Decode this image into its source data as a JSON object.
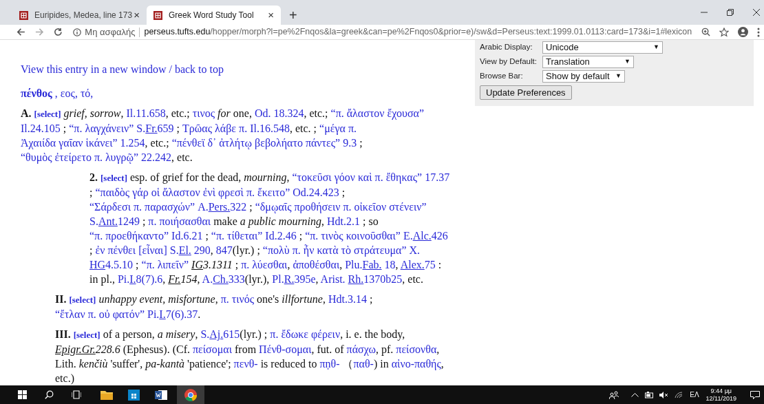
{
  "browser": {
    "tabs": [
      {
        "title": "Euripides, Medea, line 173",
        "selected": false,
        "close": "×"
      },
      {
        "title": "Greek Word Study Tool",
        "selected": true,
        "close": "×"
      }
    ],
    "new_tab": "+",
    "security_label": "Μη ασφαλής",
    "url_host": "perseus.tufts.edu",
    "url_path": "/hopper/morph?l=pe%2Fnqos&la=greek&can=pe%2Fnqos0&prior=e)/sw&d=Perseus:text:1999.01.0113:card=173&i=1#lexicon"
  },
  "nav": {
    "new_window": "View this entry in a new window",
    "separator": " / ",
    "back_to_top": "back to top"
  },
  "headword": "**πένθος** , εος, τό,",
  "senses": [
    {
      "segments": [
        {
          "kind": "label",
          "text": "A."
        },
        {
          "kind": "select",
          "text": "[select]",
          "spaced": true
        },
        {
          "kind": "plain",
          "text": " *grief, sorrow*, "
        },
        {
          "kind": "link",
          "text": "Il.11.658"
        },
        {
          "kind": "plain",
          "text": ", etc.; "
        },
        {
          "kind": "link",
          "text": "τινος"
        },
        {
          "kind": "plain",
          "text": " *for* one, "
        },
        {
          "kind": "link",
          "text": "Od. 18.324"
        },
        {
          "kind": "plain",
          "text": ", etc.; "
        },
        {
          "kind": "link",
          "text": "“π. ἄλαστον"
        },
        {
          "kind": "link",
          "text": "ἔχουσα”",
          "spaced": true
        },
        {
          "kind": "link",
          "text": "Il.24.105",
          "spaced": true
        },
        {
          "kind": "plain",
          "text": " ; "
        },
        {
          "kind": "link",
          "text": "“π. λαγχάνειν”"
        },
        {
          "kind": "link",
          "text": "S.",
          "spaced": true
        },
        {
          "kind": "ulink",
          "text": "Fr."
        },
        {
          "kind": "link",
          "text": "659"
        },
        {
          "kind": "plain",
          "text": " ; "
        },
        {
          "kind": "link",
          "text": "Τρῶας λάβε π."
        },
        {
          "kind": "link",
          "text": "Il.16.548",
          "spaced": true
        },
        {
          "kind": "plain",
          "text": ", etc. ; "
        },
        {
          "kind": "link",
          "text": "“μέγα π."
        },
        {
          "kind": "link",
          "text": "Ἀχαιίδα γαῖαν ἱκάνει”",
          "spaced": true
        },
        {
          "kind": "link",
          "text": "1.254",
          "spaced": true
        },
        {
          "kind": "plain",
          "text": ", etc.; "
        },
        {
          "kind": "link",
          "text": "“πένθεϊ δ᾽ ἀτλήτῳ βεβολήατο πάντες”"
        },
        {
          "kind": "link",
          "text": "9.3",
          "spaced": true
        },
        {
          "kind": "plain",
          "text": " ; "
        },
        {
          "kind": "link",
          "text": "“θυμὸς ἐτείρετο π. λυγρῷ”"
        },
        {
          "kind": "link",
          "text": "22.242",
          "spaced": true
        },
        {
          "kind": "plain",
          "text": ", etc."
        }
      ],
      "children": [
        {
          "children": [
            {
              "segments": [
                {
                  "kind": "label",
                  "text": "2."
                },
                {
                  "kind": "select",
                  "text": "[select]",
                  "spaced": true
                },
                {
                  "kind": "plain",
                  "text": " esp. of grief for the dead, *mourning*, "
                },
                {
                  "kind": "link",
                  "text": "“τοκεῦσι γόον καὶ π."
                },
                {
                  "kind": "link",
                  "text": "ἔθηκας”",
                  "spaced": true
                },
                {
                  "kind": "link",
                  "text": "17.37",
                  "spaced": true
                },
                {
                  "kind": "plain",
                  "text": " ; "
                },
                {
                  "kind": "link",
                  "text": "“παιδὸς γάρ οἱ ἄλαστον ἐνὶ φρεσὶ π. ἔκειτο”"
                },
                {
                  "kind": "link",
                  "text": "Od.24.423",
                  "spaced": true
                },
                {
                  "kind": "plain",
                  "text": " ; "
                },
                {
                  "kind": "link",
                  "text": "“Σάρδεσι π. παρασχών”"
                },
                {
                  "kind": "link",
                  "text": "A.",
                  "spaced": true
                },
                {
                  "kind": "ulink",
                  "text": "Pers."
                },
                {
                  "kind": "link",
                  "text": "322"
                },
                {
                  "kind": "plain",
                  "text": " ; "
                },
                {
                  "kind": "link",
                  "text": "“δμῳαῖς προθήσειν π. οἰκεῖον"
                },
                {
                  "kind": "link",
                  "text": "στένειν”",
                  "spaced": true
                },
                {
                  "kind": "link",
                  "text": "S.",
                  "spaced": true
                },
                {
                  "kind": "ulink",
                  "text": "Ant."
                },
                {
                  "kind": "link",
                  "text": "1249"
                },
                {
                  "kind": "plain",
                  "text": " ; "
                },
                {
                  "kind": "link",
                  "text": "π. ποιήσασθαι"
                },
                {
                  "kind": "plain",
                  "text": " make *a public mourning*, "
                },
                {
                  "kind": "link",
                  "text": "Hdt.2.1"
                },
                {
                  "kind": "plain",
                  "text": " ; so "
                },
                {
                  "kind": "link",
                  "text": "“π. προεθήκαντο”"
                },
                {
                  "kind": "link",
                  "text": "Id.6.21",
                  "spaced": true
                },
                {
                  "kind": "plain",
                  "text": " ; "
                },
                {
                  "kind": "link",
                  "text": "“π. τίθεται”"
                },
                {
                  "kind": "link",
                  "text": "Id.2.46",
                  "spaced": true
                },
                {
                  "kind": "plain",
                  "text": " ; "
                },
                {
                  "kind": "link",
                  "text": "“π. τινὸς"
                },
                {
                  "kind": "link",
                  "text": "κοινοῦσθαι”",
                  "spaced": true
                },
                {
                  "kind": "link",
                  "text": "E.",
                  "spaced": true
                },
                {
                  "kind": "ulink",
                  "text": "Alc."
                },
                {
                  "kind": "link",
                  "text": "426"
                },
                {
                  "kind": "plain",
                  "text": " ; "
                },
                {
                  "kind": "link",
                  "text": "ἐν πένθει [εἶναι]"
                },
                {
                  "kind": "link",
                  "text": "S.",
                  "spaced": true
                },
                {
                  "kind": "ulink",
                  "text": "El."
                },
                {
                  "kind": "link",
                  "text": "290",
                  "spaced": true
                },
                {
                  "kind": "plain",
                  "text": ", "
                },
                {
                  "kind": "link",
                  "text": "847"
                },
                {
                  "kind": "plain",
                  "text": "(lyr.) ; "
                },
                {
                  "kind": "link",
                  "text": "“πολὺ π."
                },
                {
                  "kind": "link",
                  "text": "ἦν κατὰ τὸ στράτευμα”",
                  "spaced": true
                },
                {
                  "kind": "link",
                  "text": "X.",
                  "spaced": true
                },
                {
                  "kind": "ulink",
                  "text": "HG",
                  "spaced": true
                },
                {
                  "kind": "link",
                  "text": "4.5.10"
                },
                {
                  "kind": "plain",
                  "text": " ; "
                },
                {
                  "kind": "link",
                  "text": "“π. λιπεῖν”"
                },
                {
                  "kind": "uplain",
                  "text": "*IG*",
                  "spaced": true
                },
                {
                  "kind": "plain",
                  "text": "*3.1311* ; "
                },
                {
                  "kind": "link",
                  "text": "π. λύεσθαι"
                },
                {
                  "kind": "plain",
                  "text": ", "
                },
                {
                  "kind": "link",
                  "text": "ἀποθέσθαι"
                },
                {
                  "kind": "plain",
                  "text": ", "
                },
                {
                  "kind": "link",
                  "text": "Plu."
                },
                {
                  "kind": "ulink",
                  "text": "Fab."
                },
                {
                  "kind": "link",
                  "text": "18",
                  "spaced": true
                },
                {
                  "kind": "plain",
                  "text": ", "
                },
                {
                  "kind": "ulink",
                  "text": "Alex."
                },
                {
                  "kind": "link",
                  "text": "75"
                },
                {
                  "kind": "plain",
                  "text": " : in pl., "
                },
                {
                  "kind": "link",
                  "text": "Pi."
                },
                {
                  "kind": "ulink",
                  "text": "I."
                },
                {
                  "kind": "link",
                  "text": "8(7).6"
                },
                {
                  "kind": "plain",
                  "text": ", "
                },
                {
                  "kind": "uplain",
                  "text": "*Fr.*"
                },
                {
                  "kind": "plain",
                  "text": "*154*, "
                },
                {
                  "kind": "link",
                  "text": "A."
                },
                {
                  "kind": "ulink",
                  "text": "Ch."
                },
                {
                  "kind": "link",
                  "text": "333"
                },
                {
                  "kind": "plain",
                  "text": "(lyr.), "
                },
                {
                  "kind": "link",
                  "text": "Pl."
                },
                {
                  "kind": "ulink",
                  "text": "R."
                },
                {
                  "kind": "link",
                  "text": "395e"
                },
                {
                  "kind": "plain",
                  "text": ", "
                },
                {
                  "kind": "link",
                  "text": "Arist."
                },
                {
                  "kind": "ulink",
                  "text": "Rh.",
                  "spaced": true
                },
                {
                  "kind": "link",
                  "text": "1370b25"
                },
                {
                  "kind": "plain",
                  "text": ", etc."
                }
              ]
            }
          ]
        },
        {
          "segments": [
            {
              "kind": "label",
              "text": "II."
            },
            {
              "kind": "select",
              "text": "[select]",
              "spaced": true
            },
            {
              "kind": "plain",
              "text": " *unhappy event, misfortune*, "
            },
            {
              "kind": "link",
              "text": "π. τινός"
            },
            {
              "kind": "plain",
              "text": " one's *illfortune*, "
            },
            {
              "kind": "link",
              "text": "Hdt.3.14"
            },
            {
              "kind": "plain",
              "text": " ; "
            },
            {
              "kind": "link",
              "text": "“ἔτλαν π. οὐ φατόν”"
            },
            {
              "kind": "link",
              "text": "Pi.",
              "spaced": true
            },
            {
              "kind": "ulink",
              "text": "I."
            },
            {
              "kind": "link",
              "text": "7(6).37"
            },
            {
              "kind": "plain",
              "text": "."
            }
          ]
        },
        {
          "segments": [
            {
              "kind": "label",
              "text": "III."
            },
            {
              "kind": "select",
              "text": "[select]",
              "spaced": true
            },
            {
              "kind": "plain",
              "text": " of a person, *a misery*, "
            },
            {
              "kind": "link",
              "text": "S."
            },
            {
              "kind": "ulink",
              "text": "Aj."
            },
            {
              "kind": "link",
              "text": "615"
            },
            {
              "kind": "plain",
              "text": "(lyr.) ; "
            },
            {
              "kind": "link",
              "text": "π. ἔδωκε φέρειν"
            },
            {
              "kind": "plain",
              "text": ", i. e. the body, "
            },
            {
              "kind": "uplain",
              "text": "*Epigr.Gr.*"
            },
            {
              "kind": "plain",
              "text": "*228.6* (Ephesus). (Cf. "
            },
            {
              "kind": "link",
              "text": "πείσομαι"
            },
            {
              "kind": "plain",
              "text": " from "
            },
            {
              "kind": "link",
              "text": "Πένθ-σομαι"
            },
            {
              "kind": "plain",
              "text": ", fut. of "
            },
            {
              "kind": "link",
              "text": "πάσχω"
            },
            {
              "kind": "plain",
              "text": ", pf. "
            },
            {
              "kind": "link",
              "text": "πείσονθα"
            },
            {
              "kind": "plain",
              "text": ", Lith. *kenčiù* 'suffer', *pa-kantà* 'patience'; "
            },
            {
              "kind": "link",
              "text": "πενθ-"
            },
            {
              "kind": "plain",
              "text": " is reduced to "
            },
            {
              "kind": "link",
              "text": "πṇθ-"
            },
            {
              "kind": "plain",
              "text": " （"
            },
            {
              "kind": "link",
              "text": "παθ-"
            },
            {
              "kind": "plain",
              "text": ") in "
            },
            {
              "kind": "link",
              "text": "αἰνο-παθής"
            },
            {
              "kind": "plain",
              "text": ", etc.)"
            }
          ]
        }
      ]
    }
  ],
  "preferences": {
    "rows": [
      {
        "label": "Arabic Display:",
        "value": "Unicode",
        "caret": "▼"
      },
      {
        "label": "View by Default:",
        "value": "Translation",
        "caret": "▼"
      },
      {
        "label": "Browse Bar:",
        "value": "Show by default",
        "caret": "▼"
      }
    ],
    "button": "Update Preferences"
  },
  "taskbar": {
    "language": "ΕΛ",
    "time": "9:44 μμ",
    "date": "12/11/2019"
  }
}
